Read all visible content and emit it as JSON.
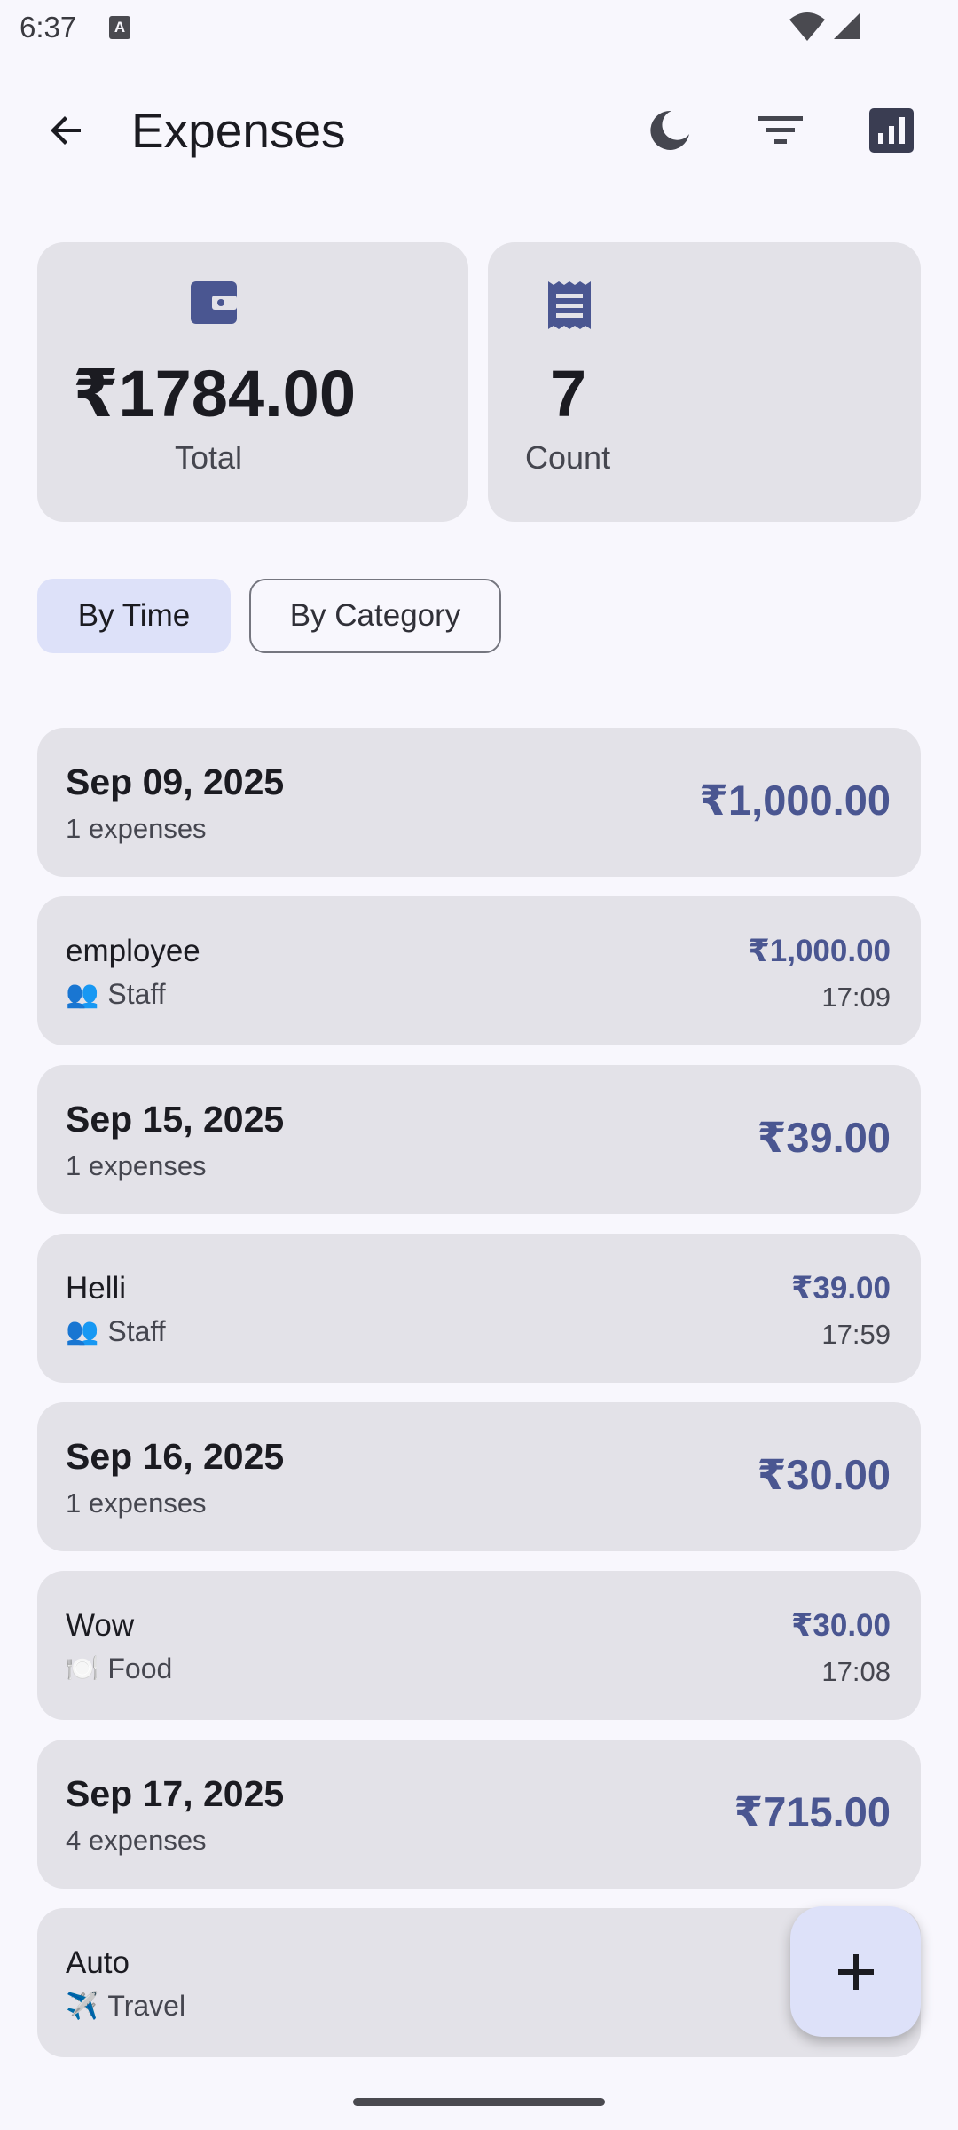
{
  "status_bar": {
    "time": "6:37",
    "notification_letter": "A"
  },
  "app_bar": {
    "title": "Expenses",
    "icons": {
      "back": "arrow-back-icon",
      "theme": "moon-icon",
      "filter": "filter-icon",
      "stats": "bar-chart-icon"
    }
  },
  "summary": {
    "total": {
      "value": "₹1784.00",
      "label": "Total",
      "icon": "wallet-icon"
    },
    "count": {
      "value": "7",
      "label": "Count",
      "icon": "receipt-icon"
    }
  },
  "view_toggle": {
    "by_time": "By Time",
    "by_category": "By Category",
    "selected": "By Time"
  },
  "groups": [
    {
      "date": "Sep 09, 2025",
      "count": "1 expenses",
      "amount": "₹1,000.00",
      "items": [
        {
          "title": "employee",
          "category": "Staff",
          "emoji": "👥",
          "amount": "₹1,000.00",
          "time": "17:09"
        }
      ]
    },
    {
      "date": "Sep 15, 2025",
      "count": "1 expenses",
      "amount": "₹39.00",
      "items": [
        {
          "title": "Helli",
          "category": "Staff",
          "emoji": "👥",
          "amount": "₹39.00",
          "time": "17:59"
        }
      ]
    },
    {
      "date": "Sep 16, 2025",
      "count": "1 expenses",
      "amount": "₹30.00",
      "items": [
        {
          "title": "Wow",
          "category": "Food",
          "emoji": "🍽️",
          "amount": "₹30.00",
          "time": "17:08"
        }
      ]
    },
    {
      "date": "Sep 17, 2025",
      "count": "4 expenses",
      "amount": "₹715.00",
      "items": [
        {
          "title": "Auto",
          "category": "Travel",
          "emoji": "✈️",
          "amount": "₹",
          "time": ""
        }
      ]
    }
  ],
  "fab": {
    "icon": "plus-icon"
  },
  "colors": {
    "accent": "#4a5691",
    "card": "#e3e2e8",
    "selected_chip": "#dde1f9",
    "background": "#f8f7fd"
  }
}
